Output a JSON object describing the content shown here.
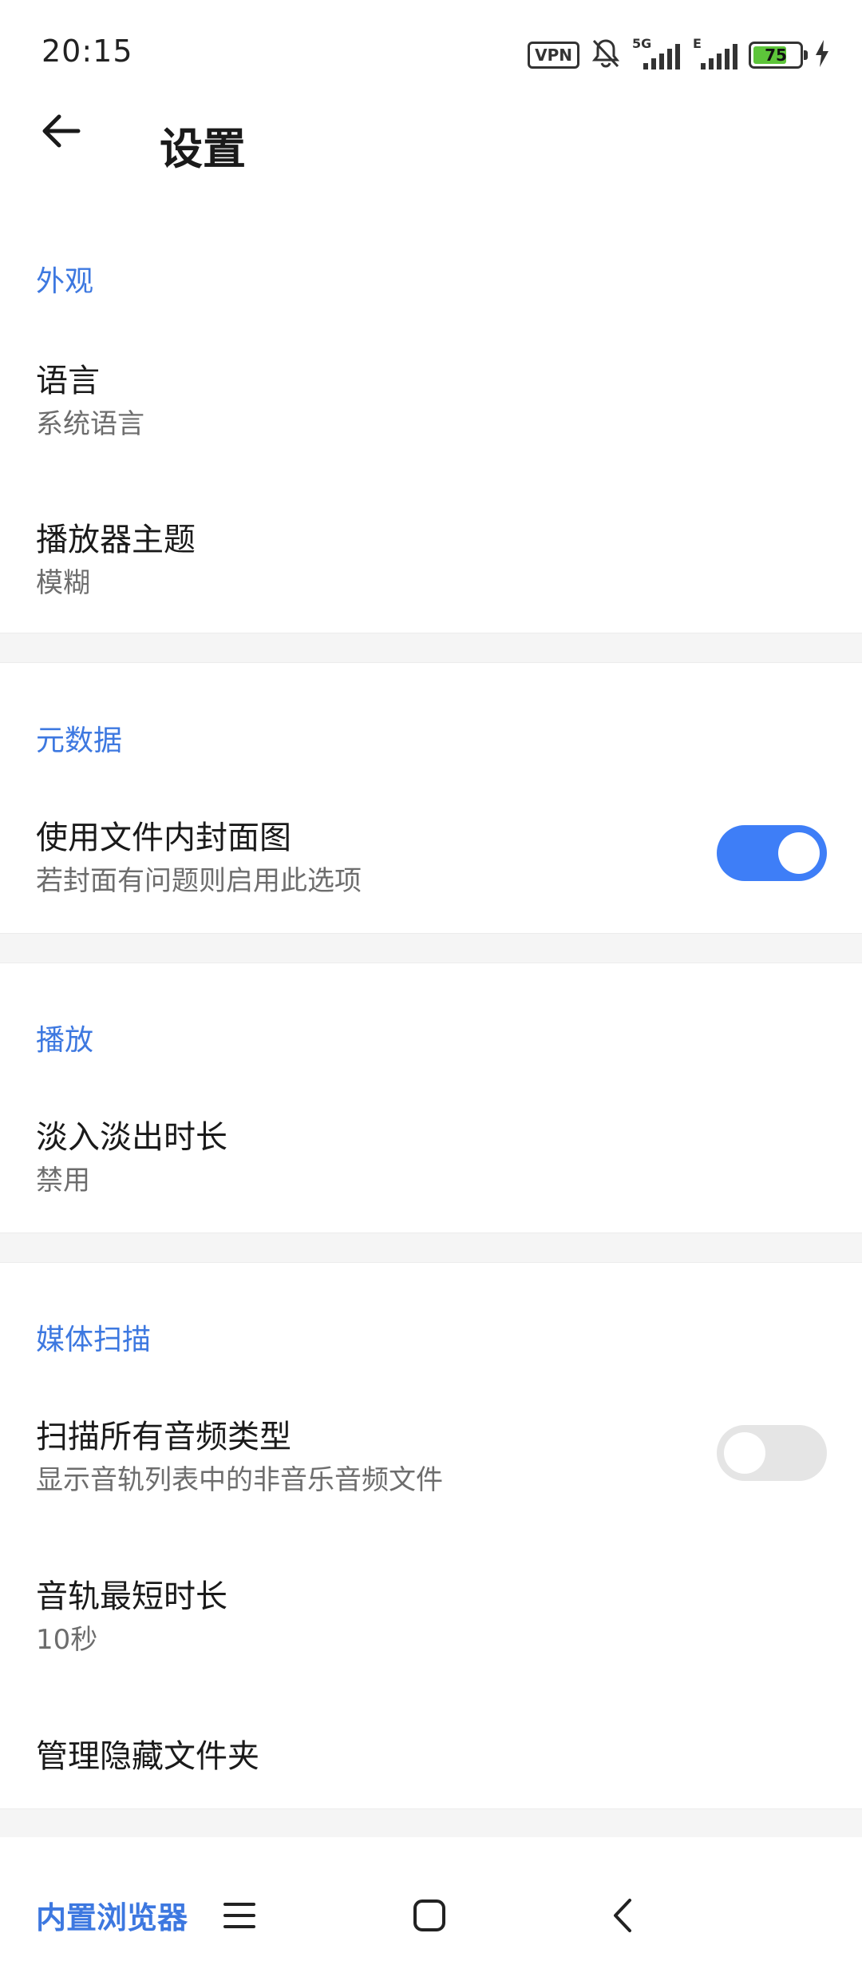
{
  "status_bar": {
    "time": "20:15",
    "vpn": "VPN",
    "network": "5G",
    "network2": "E",
    "battery_level": 75,
    "battery_text": "75"
  },
  "header": {
    "title": "设置"
  },
  "sections": {
    "appearance": {
      "header": "外观",
      "language_title": "语言",
      "language_value": "系统语言",
      "theme_title": "播放器主题",
      "theme_value": "模糊"
    },
    "metadata": {
      "header": "元数据",
      "cover_title": "使用文件内封面图",
      "cover_sub": "若封面有问题则启用此选项",
      "cover_enabled": true
    },
    "playback": {
      "header": "播放",
      "fade_title": "淡入淡出时长",
      "fade_value": "禁用"
    },
    "media_scan": {
      "header": "媒体扫描",
      "scan_all_title": "扫描所有音频类型",
      "scan_all_sub": "显示音轨列表中的非音乐音频文件",
      "scan_all_enabled": false,
      "min_duration_title": "音轨最短时长",
      "min_duration_value": "10秒",
      "hidden_folders_title": "管理隐藏文件夹"
    },
    "next": {
      "header": "内置浏览器"
    }
  },
  "colors": {
    "accent": "#3d78e0",
    "toggle_on": "#3e7ef7",
    "toggle_off": "#e5e5e5",
    "battery": "#5dc53a"
  },
  "icons": {
    "back": "arrow-left-icon",
    "menu": "menu-icon",
    "home": "home-square-icon",
    "nav_back": "chevron-left-icon"
  }
}
